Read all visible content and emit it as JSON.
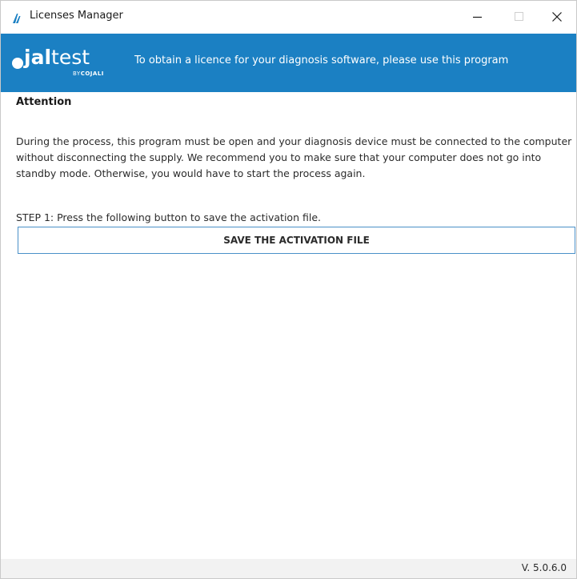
{
  "window": {
    "title": "Licenses Manager",
    "icons": {
      "app": "jaltest-app-icon",
      "minimize": "minimize-icon",
      "maximize": "maximize-icon",
      "close": "close-icon"
    }
  },
  "banner": {
    "logo": {
      "main_prefix": "jal",
      "main_suffix": "test",
      "sub_by": "BY",
      "sub_brand": "COJALI"
    },
    "tagline": "To obtain a licence for your diagnosis software, please use this program",
    "background_color": "#1b80c3"
  },
  "content": {
    "heading": "Attention",
    "paragraph": "During the process, this program must be open and your diagnosis device must be connected to the computer without disconnecting the supply. We recommend you to make sure that your computer does not go into standby mode. Otherwise, you would have to start the process again.",
    "step1_label": "STEP 1: Press the following button to save the activation file.",
    "save_button_label": "SAVE THE ACTIVATION FILE"
  },
  "status_bar": {
    "version": "V. 5.0.6.0"
  }
}
